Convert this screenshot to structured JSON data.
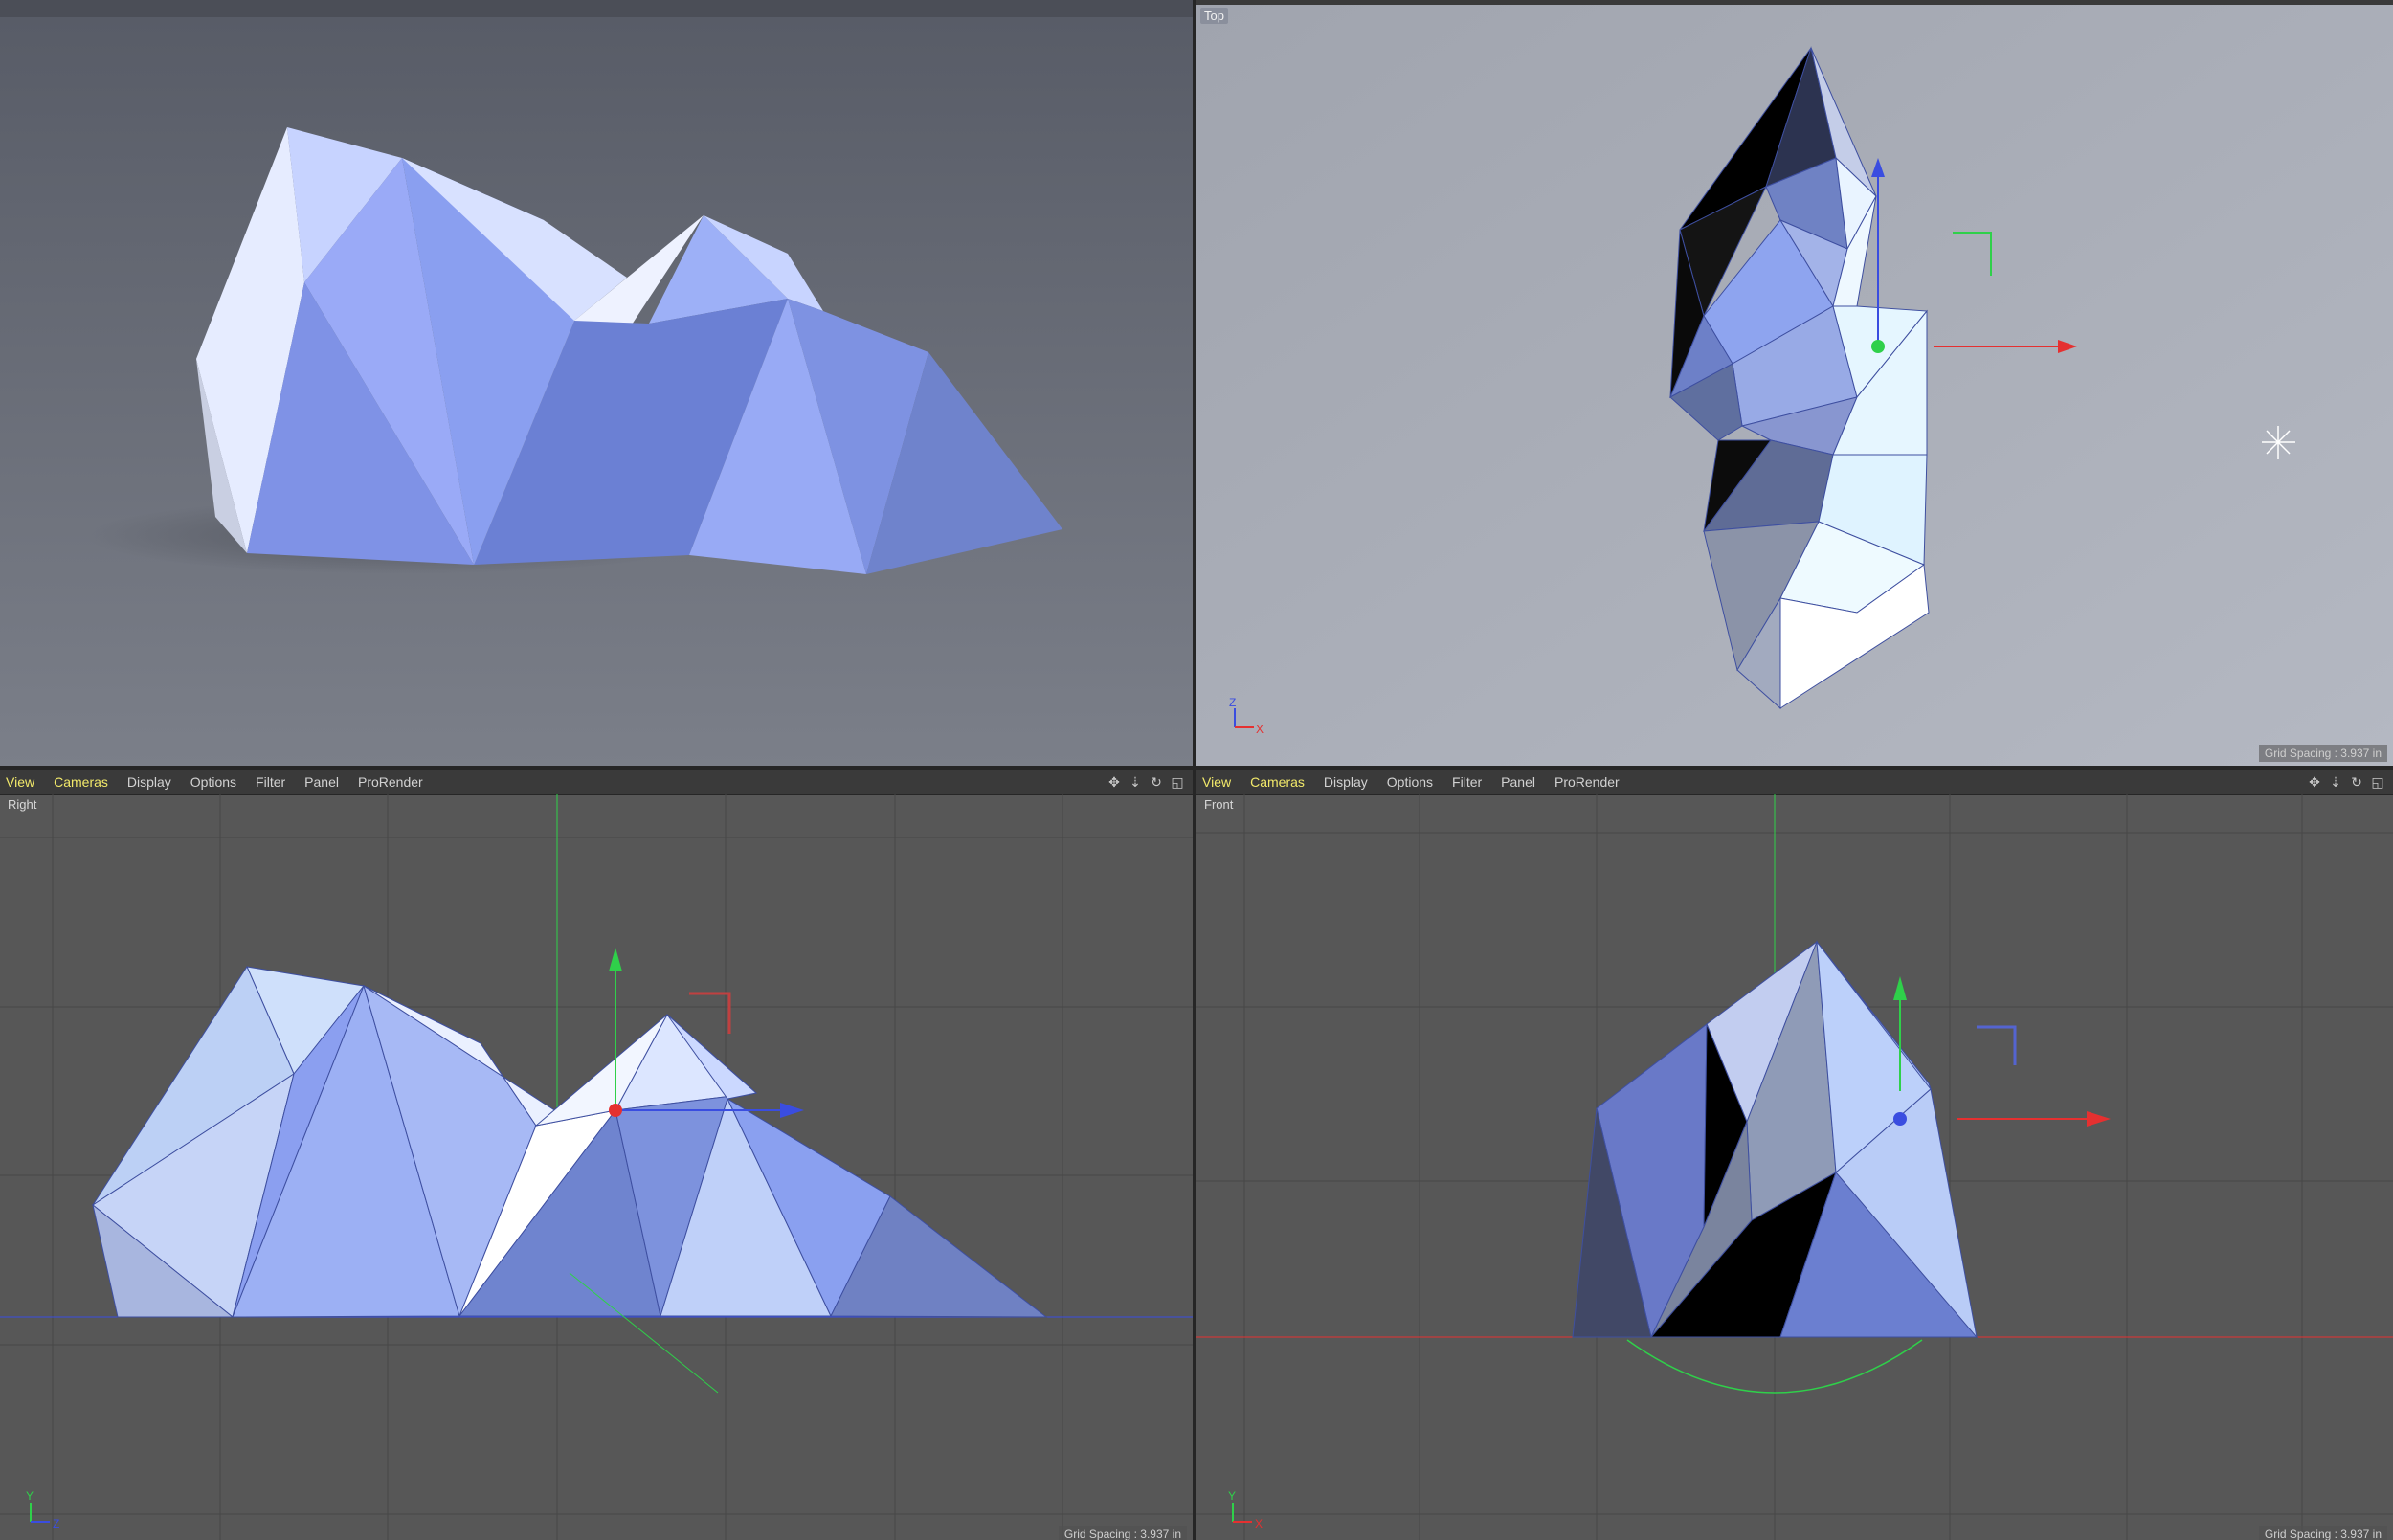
{
  "menu": {
    "items": [
      "View",
      "Cameras",
      "Display",
      "Options",
      "Filter",
      "Panel",
      "ProRender"
    ],
    "active": "Cameras"
  },
  "viewports": {
    "perspective": {
      "label": ""
    },
    "top": {
      "label": "Top",
      "grid_spacing": "Grid Spacing : 3.937 in",
      "axis_labels": [
        "Z",
        "X"
      ]
    },
    "right": {
      "label": "Right",
      "grid_spacing": "Grid Spacing : 3.937 in",
      "axis_labels": [
        "Y",
        "Z"
      ]
    },
    "front": {
      "label": "Front",
      "grid_spacing": "Grid Spacing : 3.937 in",
      "axis_labels": [
        "Y",
        "X"
      ]
    }
  },
  "colors": {
    "accent_active_menu": "#f2e96a",
    "model_light": "#c9d6ff",
    "model_mid": "#8fa3ef",
    "model_dark": "#5f73c4",
    "axis_x": "#e53030",
    "axis_y": "#2fd04a",
    "axis_z": "#3a4de0",
    "viewport_bg": "#575757"
  },
  "icons": [
    "move-view-icon",
    "zoom-view-icon",
    "rotate-view-icon",
    "maximize-view-icon"
  ]
}
